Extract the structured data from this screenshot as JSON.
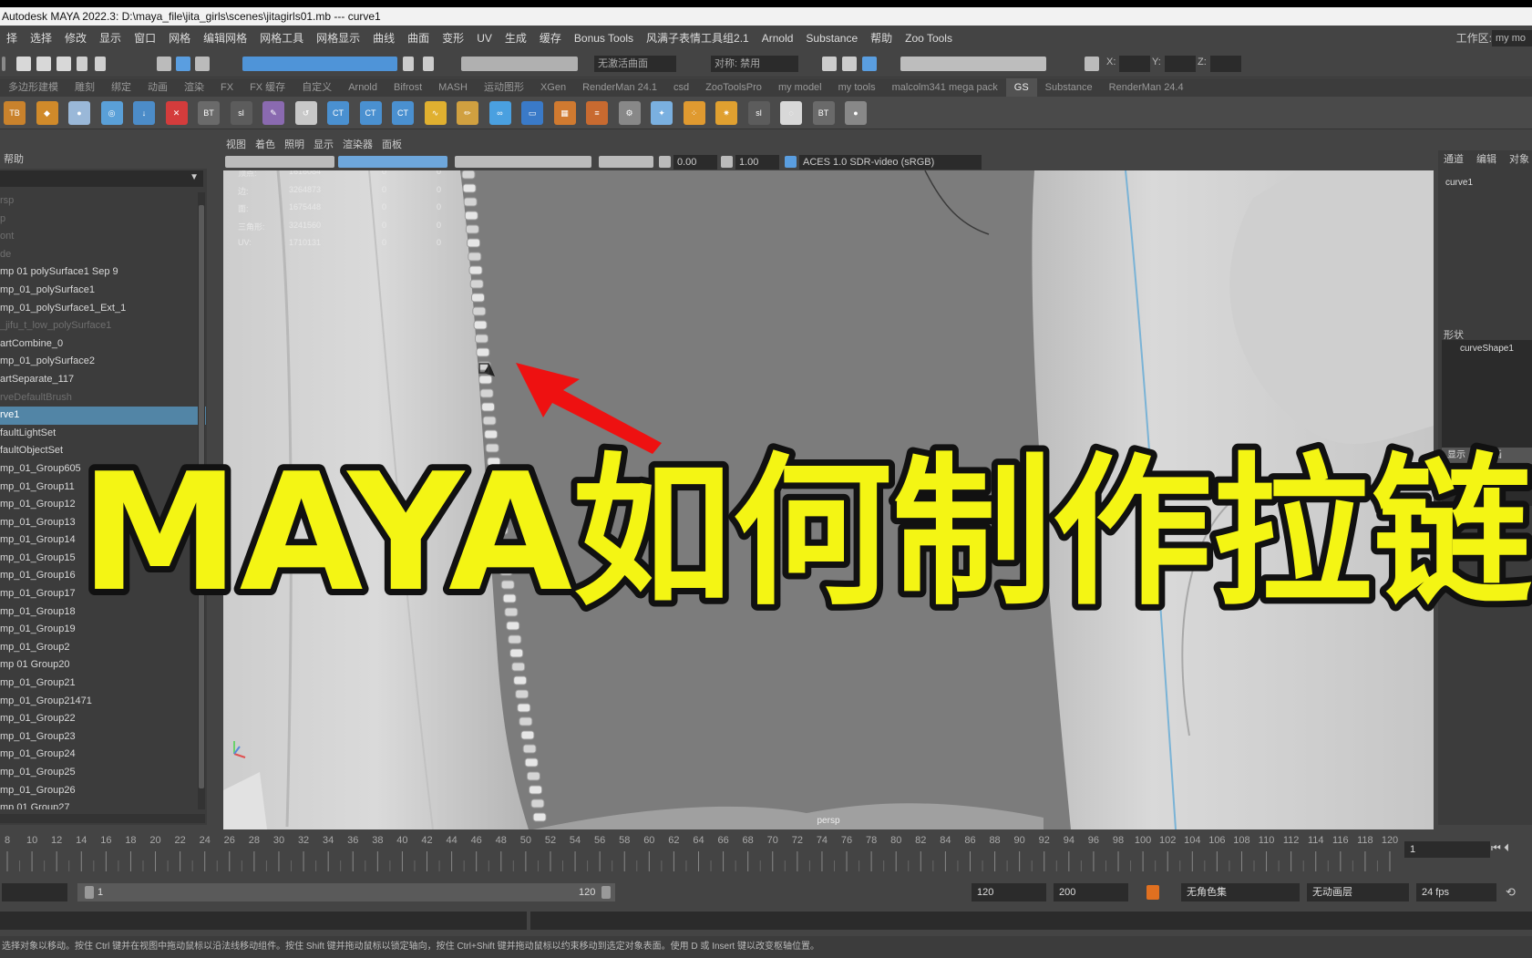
{
  "window": {
    "title": "Autodesk MAYA 2022.3: D:\\maya_file\\jita_girls\\scenes\\jitagirls01.mb  ---  curve1"
  },
  "menubar": {
    "items": [
      "择",
      "选择",
      "修改",
      "显示",
      "窗口",
      "网格",
      "编辑网格",
      "网格工具",
      "网格显示",
      "曲线",
      "曲面",
      "变形",
      "UV",
      "生成",
      "缓存",
      "Bonus Tools",
      "风满子表情工具组2.1",
      "Arnold",
      "Substance",
      "帮助",
      "Zoo Tools"
    ],
    "workspace_label": "工作区:",
    "workspace_value": "my mo"
  },
  "statusline": {
    "no_live_surface": "无激活曲面",
    "symmetry": "对称: 禁用",
    "x_label": "X:",
    "y_label": "Y:",
    "z_label": "Z:"
  },
  "shelf": {
    "tabs": [
      "多边形建模",
      "雕刻",
      "绑定",
      "动画",
      "渲染",
      "FX",
      "FX 缓存",
      "自定义",
      "Arnold",
      "Bifrost",
      "MASH",
      "运动图形",
      "XGen",
      "RenderMan 24.1",
      "csd",
      "ZooToolsPro",
      "my model",
      "my tools",
      "malcolm341 mega pack",
      "GS",
      "Substance",
      "RenderMan 24.4"
    ],
    "active_tab": "GS",
    "icons": [
      {
        "name": "tb-del-icon",
        "text": "TB",
        "color": "#c9822c"
      },
      {
        "name": "diamond-icon",
        "text": "◆",
        "color": "#d08a2a"
      },
      {
        "name": "pin-icon",
        "text": "●",
        "color": "#9ab8d8"
      },
      {
        "name": "target-icon",
        "text": "◎",
        "color": "#5aa0d8"
      },
      {
        "name": "arrows-down-icon",
        "text": "↓",
        "color": "#4c8cc8"
      },
      {
        "name": "ray-icon",
        "text": "✕",
        "color": "#d43c3c"
      },
      {
        "name": "bonus-tool-icon",
        "text": "BT",
        "color": "#6a6a6a"
      },
      {
        "name": "slda-icon",
        "text": "sl",
        "color": "#5c5c5c"
      },
      {
        "name": "brush-icon",
        "text": "✎",
        "color": "#8a6ab0"
      },
      {
        "name": "history-icon",
        "text": "↺",
        "color": "#c8c8c8"
      },
      {
        "name": "ct-ui-icon",
        "text": "CT",
        "color": "#4a90d0"
      },
      {
        "name": "ct-icon",
        "text": "CT",
        "color": "#4a90d0"
      },
      {
        "name": "ct-del-icon",
        "text": "CT",
        "color": "#4a90d0"
      },
      {
        "name": "curve-icon",
        "text": "∿",
        "color": "#e0b030"
      },
      {
        "name": "pencil-icon",
        "text": "✏",
        "color": "#d0a040"
      },
      {
        "name": "lasso-icon",
        "text": "∞",
        "color": "#4aa0e0"
      },
      {
        "name": "plane-icon",
        "text": "▭",
        "color": "#3a7ac8"
      },
      {
        "name": "grid-icon",
        "text": "▦",
        "color": "#d07a30"
      },
      {
        "name": "align-icon",
        "text": "≡",
        "color": "#c86a30"
      },
      {
        "name": "settings-icon",
        "text": "⚙",
        "color": "#888888"
      },
      {
        "name": "node-icon",
        "text": "✦",
        "color": "#7ab0e0"
      },
      {
        "name": "dot-grid-icon",
        "text": "⁘",
        "color": "#e09a30"
      },
      {
        "name": "star-icon",
        "text": "✷",
        "color": "#e0a030"
      },
      {
        "name": "slda2-icon",
        "text": "sl",
        "color": "#5c5c5c"
      },
      {
        "name": "bulb-icon",
        "text": "◌",
        "color": "#d8d8d8"
      },
      {
        "name": "bonus-tool-sc-icon",
        "text": "BT",
        "color": "#6a6a6a"
      },
      {
        "name": "sphere-icon",
        "text": "●",
        "color": "#888888"
      }
    ]
  },
  "outliner": {
    "menu_label": "帮助",
    "items": [
      {
        "label": "rsp",
        "dim": true
      },
      {
        "label": "p",
        "dim": true
      },
      {
        "label": "ont",
        "dim": true
      },
      {
        "label": "de",
        "dim": true
      },
      {
        "label": "mp 01 polySurface1 Sep 9",
        "dim": false
      },
      {
        "label": "mp_01_polySurface1",
        "dim": false
      },
      {
        "label": "mp_01_polySurface1_Ext_1",
        "dim": false
      },
      {
        "label": "_jifu_t_low_polySurface1",
        "dim": true
      },
      {
        "label": "artCombine_0",
        "dim": false
      },
      {
        "label": "mp_01_polySurface2",
        "dim": false
      },
      {
        "label": "artSeparate_117",
        "dim": false
      },
      {
        "label": "rveDefaultBrush",
        "dim": true
      },
      {
        "label": "rve1",
        "dim": false,
        "selected": true
      },
      {
        "label": "faultLightSet",
        "dim": false
      },
      {
        "label": "faultObjectSet",
        "dim": false
      },
      {
        "label": "mp_01_Group605",
        "dim": false
      },
      {
        "label": "mp_01_Group11",
        "dim": false
      },
      {
        "label": "mp_01_Group12",
        "dim": false
      },
      {
        "label": "mp_01_Group13",
        "dim": false
      },
      {
        "label": "mp_01_Group14",
        "dim": false
      },
      {
        "label": "mp_01_Group15",
        "dim": false
      },
      {
        "label": "mp_01_Group16",
        "dim": false
      },
      {
        "label": "mp_01_Group17",
        "dim": false
      },
      {
        "label": "mp_01_Group18",
        "dim": false
      },
      {
        "label": "mp_01_Group19",
        "dim": false
      },
      {
        "label": "mp_01_Group2",
        "dim": false
      },
      {
        "label": "mp 01 Group20",
        "dim": false
      },
      {
        "label": "mp_01_Group21",
        "dim": false
      },
      {
        "label": "mp_01_Group21471",
        "dim": false
      },
      {
        "label": "mp_01_Group22",
        "dim": false
      },
      {
        "label": "mp_01_Group23",
        "dim": false
      },
      {
        "label": "mp_01_Group24",
        "dim": false
      },
      {
        "label": "mp_01_Group25",
        "dim": false
      },
      {
        "label": "mp_01_Group26",
        "dim": false
      },
      {
        "label": "mp 01 Group27",
        "dim": false
      }
    ]
  },
  "viewport": {
    "menu": [
      "视图",
      "着色",
      "照明",
      "显示",
      "渲染器",
      "面板"
    ],
    "exposure": "0.00",
    "gamma": "1.00",
    "color_space": "ACES 1.0 SDR-video (sRGB)",
    "camera_label": "persp",
    "hud": [
      {
        "key": "顶点:",
        "value": "1616084",
        "a": "0",
        "b": "0"
      },
      {
        "key": "边:",
        "value": "3264873",
        "a": "0",
        "b": "0"
      },
      {
        "key": "面:",
        "value": "1675448",
        "a": "0",
        "b": "0"
      },
      {
        "key": "三角形:",
        "value": "3241560",
        "a": "0",
        "b": "0"
      },
      {
        "key": "UV:",
        "value": "1710131",
        "a": "0",
        "b": "0"
      }
    ]
  },
  "channel_box": {
    "tabs": [
      "通道",
      "编辑",
      "对象"
    ],
    "node_name": "curve1",
    "shapes_label": "形状",
    "shape_name": "curveShape1",
    "display_tabs": [
      "显示",
      "动画"
    ]
  },
  "timeline": {
    "ticks": [
      8,
      10,
      12,
      14,
      16,
      18,
      20,
      22,
      24,
      26,
      28,
      30,
      32,
      34,
      36,
      38,
      40,
      42,
      44,
      46,
      48,
      50,
      52,
      54,
      56,
      58,
      60,
      62,
      64,
      66,
      68,
      70,
      72,
      74,
      76,
      78,
      80,
      82,
      84,
      86,
      88,
      90,
      92,
      94,
      96,
      98,
      100,
      102,
      104,
      106,
      108,
      110,
      112,
      114,
      116,
      118,
      120
    ],
    "current_frame": "1",
    "range_start": "1",
    "range_end": "120",
    "anim_end": "120",
    "anim_total": "200",
    "character_set": "无角色集",
    "anim_layer": "无动画层",
    "fps": "24 fps"
  },
  "helpline": {
    "text": "选择对象以移动。按住 Ctrl 键并在视图中拖动鼠标以沿法线移动组件。按住 Shift 键并拖动鼠标以锁定轴向，按住 Ctrl+Shift 键并拖动鼠标以约束移动到选定对象表面。使用 D 或 Insert 键以改变枢轴位置。"
  },
  "overlay": {
    "title": "MAYA如何制作拉链",
    "fill_color": "#f4f514",
    "stroke_color": "#111111"
  },
  "annotation": {
    "arrow_color": "#ee1111"
  }
}
